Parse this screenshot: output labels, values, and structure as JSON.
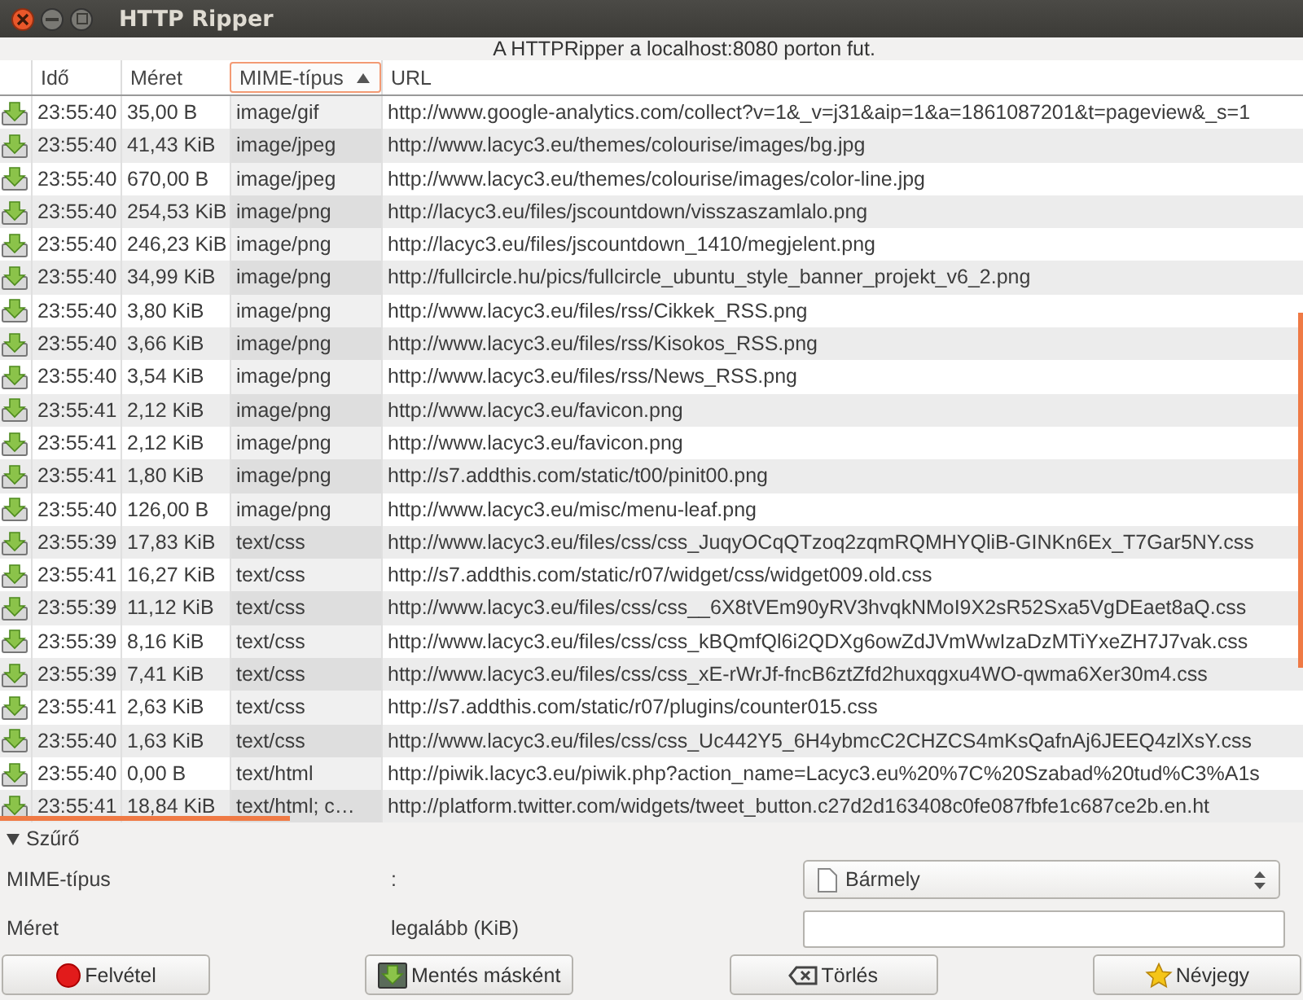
{
  "window": {
    "title": "HTTP Ripper"
  },
  "status": "A HTTPRipper a localhost:8080 porton fut.",
  "table": {
    "columns": [
      {
        "label": "Idő",
        "sorted": false
      },
      {
        "label": "Méret",
        "sorted": false
      },
      {
        "label": "MIME-típus",
        "sorted": true
      },
      {
        "label": "URL",
        "sorted": false
      }
    ],
    "rows": [
      [
        "23:55:40",
        "35,00 B",
        "image/gif",
        "http://www.google-analytics.com/collect?v=1&_v=j31&aip=1&a=1861087201&t=pageview&_s=1"
      ],
      [
        "23:55:40",
        "41,43 KiB",
        "image/jpeg",
        "http://www.lacyc3.eu/themes/colourise/images/bg.jpg"
      ],
      [
        "23:55:40",
        "670,00 B",
        "image/jpeg",
        "http://www.lacyc3.eu/themes/colourise/images/color-line.jpg"
      ],
      [
        "23:55:40",
        "254,53 KiB",
        "image/png",
        "http://lacyc3.eu/files/jscountdown/visszaszamlalo.png"
      ],
      [
        "23:55:40",
        "246,23 KiB",
        "image/png",
        "http://lacyc3.eu/files/jscountdown_1410/megjelent.png"
      ],
      [
        "23:55:40",
        "34,99 KiB",
        "image/png",
        "http://fullcircle.hu/pics/fullcircle_ubuntu_style_banner_projekt_v6_2.png"
      ],
      [
        "23:55:40",
        "3,80 KiB",
        "image/png",
        "http://www.lacyc3.eu/files/rss/Cikkek_RSS.png"
      ],
      [
        "23:55:40",
        "3,66 KiB",
        "image/png",
        "http://www.lacyc3.eu/files/rss/Kisokos_RSS.png"
      ],
      [
        "23:55:40",
        "3,54 KiB",
        "image/png",
        "http://www.lacyc3.eu/files/rss/News_RSS.png"
      ],
      [
        "23:55:41",
        "2,12 KiB",
        "image/png",
        "http://www.lacyc3.eu/favicon.png"
      ],
      [
        "23:55:41",
        "2,12 KiB",
        "image/png",
        "http://www.lacyc3.eu/favicon.png"
      ],
      [
        "23:55:41",
        "1,80 KiB",
        "image/png",
        "http://s7.addthis.com/static/t00/pinit00.png"
      ],
      [
        "23:55:40",
        "126,00 B",
        "image/png",
        "http://www.lacyc3.eu/misc/menu-leaf.png"
      ],
      [
        "23:55:39",
        "17,83 KiB",
        "text/css",
        "http://www.lacyc3.eu/files/css/css_JuqyOCqQTzoq2zqmRQMHYQliB-GINKn6Ex_T7Gar5NY.css"
      ],
      [
        "23:55:41",
        "16,27 KiB",
        "text/css",
        "http://s7.addthis.com/static/r07/widget/css/widget009.old.css"
      ],
      [
        "23:55:39",
        "11,12 KiB",
        "text/css",
        "http://www.lacyc3.eu/files/css/css__6X8tVEm90yRV3hvqkNMoI9X2sR52Sxa5VgDEaet8aQ.css"
      ],
      [
        "23:55:39",
        "8,16 KiB",
        "text/css",
        "http://www.lacyc3.eu/files/css/css_kBQmfQl6i2QDXg6owZdJVmWwIzaDzMTiYxeZH7J7vak.css"
      ],
      [
        "23:55:39",
        "7,41 KiB",
        "text/css",
        "http://www.lacyc3.eu/files/css/css_xE-rWrJf-fncB6ztZfd2huxqgxu4WO-qwma6Xer30m4.css"
      ],
      [
        "23:55:41",
        "2,63 KiB",
        "text/css",
        "http://s7.addthis.com/static/r07/plugins/counter015.css"
      ],
      [
        "23:55:40",
        "1,63 KiB",
        "text/css",
        "http://www.lacyc3.eu/files/css/css_Uc442Y5_6H4ybmcC2CHZCS4mKsQafnAj6JEEQ4zlXsY.css"
      ],
      [
        "23:55:40",
        "0,00 B",
        "text/html",
        "http://piwik.lacyc3.eu/piwik.php?action_name=Lacyc3.eu%20%7C%20Szabad%20tud%C3%A1s"
      ],
      [
        "23:55:41",
        "18,84 KiB",
        "text/html; c…",
        "http://platform.twitter.com/widgets/tweet_button.c27d2d163408c0fe087fbfe1c687ce2b.en.ht"
      ]
    ]
  },
  "filter": {
    "label": "Szűrő",
    "expanded": true,
    "fields": [
      {
        "label": "MIME-típus",
        "qualifier": ":",
        "kind": "select",
        "value": "Bármely"
      },
      {
        "label": "Méret",
        "qualifier": "legalább (KiB)",
        "kind": "input"
      }
    ]
  },
  "buttons": [
    {
      "label": "Felvétel",
      "kind": "record"
    },
    {
      "label": "Mentés másként",
      "kind": "save"
    },
    {
      "label": "Törlés",
      "kind": "clear"
    },
    {
      "label": "Névjegy",
      "kind": "about"
    }
  ]
}
